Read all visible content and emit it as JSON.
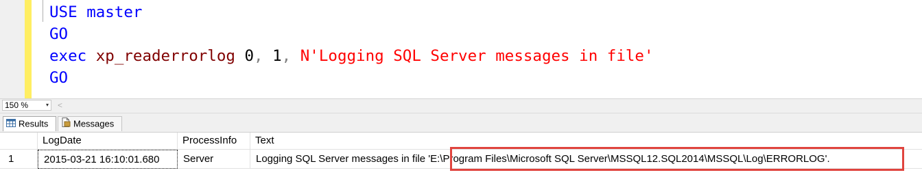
{
  "editor": {
    "lines": [
      [
        {
          "text": "USE",
          "cls": "kw"
        },
        {
          "text": " ",
          "cls": ""
        },
        {
          "text": "master",
          "cls": "kw"
        }
      ],
      [
        {
          "text": "GO",
          "cls": "kw"
        }
      ],
      [
        {
          "text": "exec",
          "cls": "kw"
        },
        {
          "text": " ",
          "cls": ""
        },
        {
          "text": "xp_readerrorlog",
          "cls": "fn"
        },
        {
          "text": " ",
          "cls": ""
        },
        {
          "text": "0",
          "cls": "num"
        },
        {
          "text": ",",
          "cls": "punct"
        },
        {
          "text": " ",
          "cls": ""
        },
        {
          "text": "1",
          "cls": "num"
        },
        {
          "text": ",",
          "cls": "punct"
        },
        {
          "text": " ",
          "cls": ""
        },
        {
          "text": "N'Logging SQL Server messages in file'",
          "cls": "str"
        }
      ],
      [
        {
          "text": "GO",
          "cls": "kw"
        }
      ]
    ]
  },
  "zoom": {
    "value": "150 %",
    "dropdown_icon": "▾",
    "scroll_left_icon": "<"
  },
  "tabs": [
    {
      "label": "Results",
      "icon": "grid-icon"
    },
    {
      "label": "Messages",
      "icon": "document-icon"
    }
  ],
  "grid": {
    "columns": [
      "LogDate",
      "ProcessInfo",
      "Text"
    ],
    "rows": [
      {
        "num": "1",
        "LogDate": "2015-03-21 16:10:01.680",
        "ProcessInfo": "Server",
        "Text": "Logging SQL Server messages in file 'E:\\Program Files\\Microsoft SQL Server\\MSSQL12.SQL2014\\MSSQL\\Log\\ERRORLOG'."
      }
    ]
  },
  "colors": {
    "keyword": "#0000ff",
    "function": "#800000",
    "string": "#ff0000",
    "punctuation": "#808080",
    "highlight_box": "#e0443e",
    "margin": "#ffee62"
  }
}
